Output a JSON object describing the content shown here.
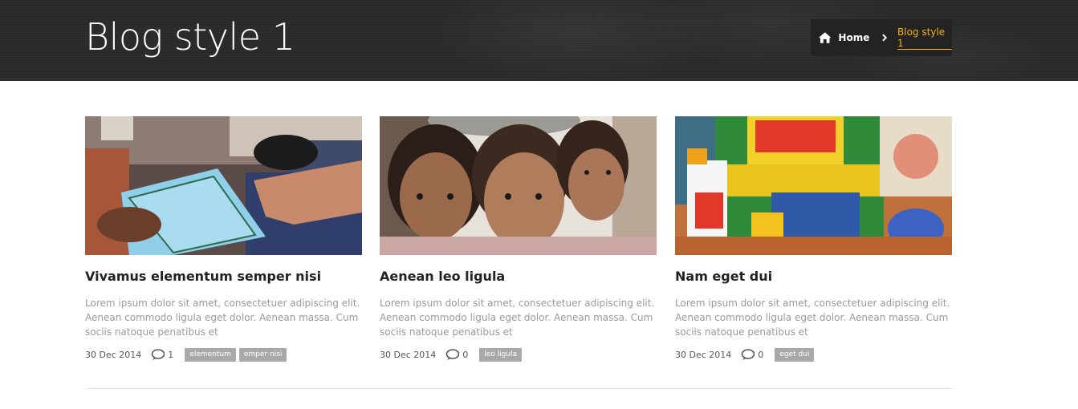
{
  "header": {
    "title": "Blog style 1",
    "breadcrumb": {
      "home": "Home",
      "current": "Blog style 1"
    }
  },
  "posts": [
    {
      "title": "Vivamus elementum semper nisi",
      "excerpt": "Lorem ipsum dolor sit amet, consectetuer adipiscing elit. Aenean commodo ligula eget dolor. Aenean massa. Cum sociis natoque penatibus et",
      "date": "30 Dec 2014",
      "comments": "1",
      "tags": [
        "elementum",
        "emper nisi"
      ],
      "image": "notebook-handover-photo"
    },
    {
      "title": "Aenean leo ligula",
      "excerpt": "Lorem ipsum dolor sit amet, consectetuer adipiscing elit. Aenean commodo ligula eget dolor. Aenean massa. Cum sociis natoque penatibus et",
      "date": "30 Dec 2014",
      "comments": "0",
      "tags": [
        "leo ligula"
      ],
      "image": "children-portrait-photo"
    },
    {
      "title": "Nam eget dui",
      "excerpt": "Lorem ipsum dolor sit amet, consectetuer adipiscing elit. Aenean commodo ligula eget dolor. Aenean massa. Cum sociis natoque penatibus et",
      "date": "30 Dec 2014",
      "comments": "0",
      "tags": [
        "eget dui"
      ],
      "image": "school-supplies-photo"
    }
  ],
  "colors": {
    "header_bg": "#2a2a2a",
    "accent": "#f4b400",
    "tag_bg": "#a9a9a9"
  }
}
